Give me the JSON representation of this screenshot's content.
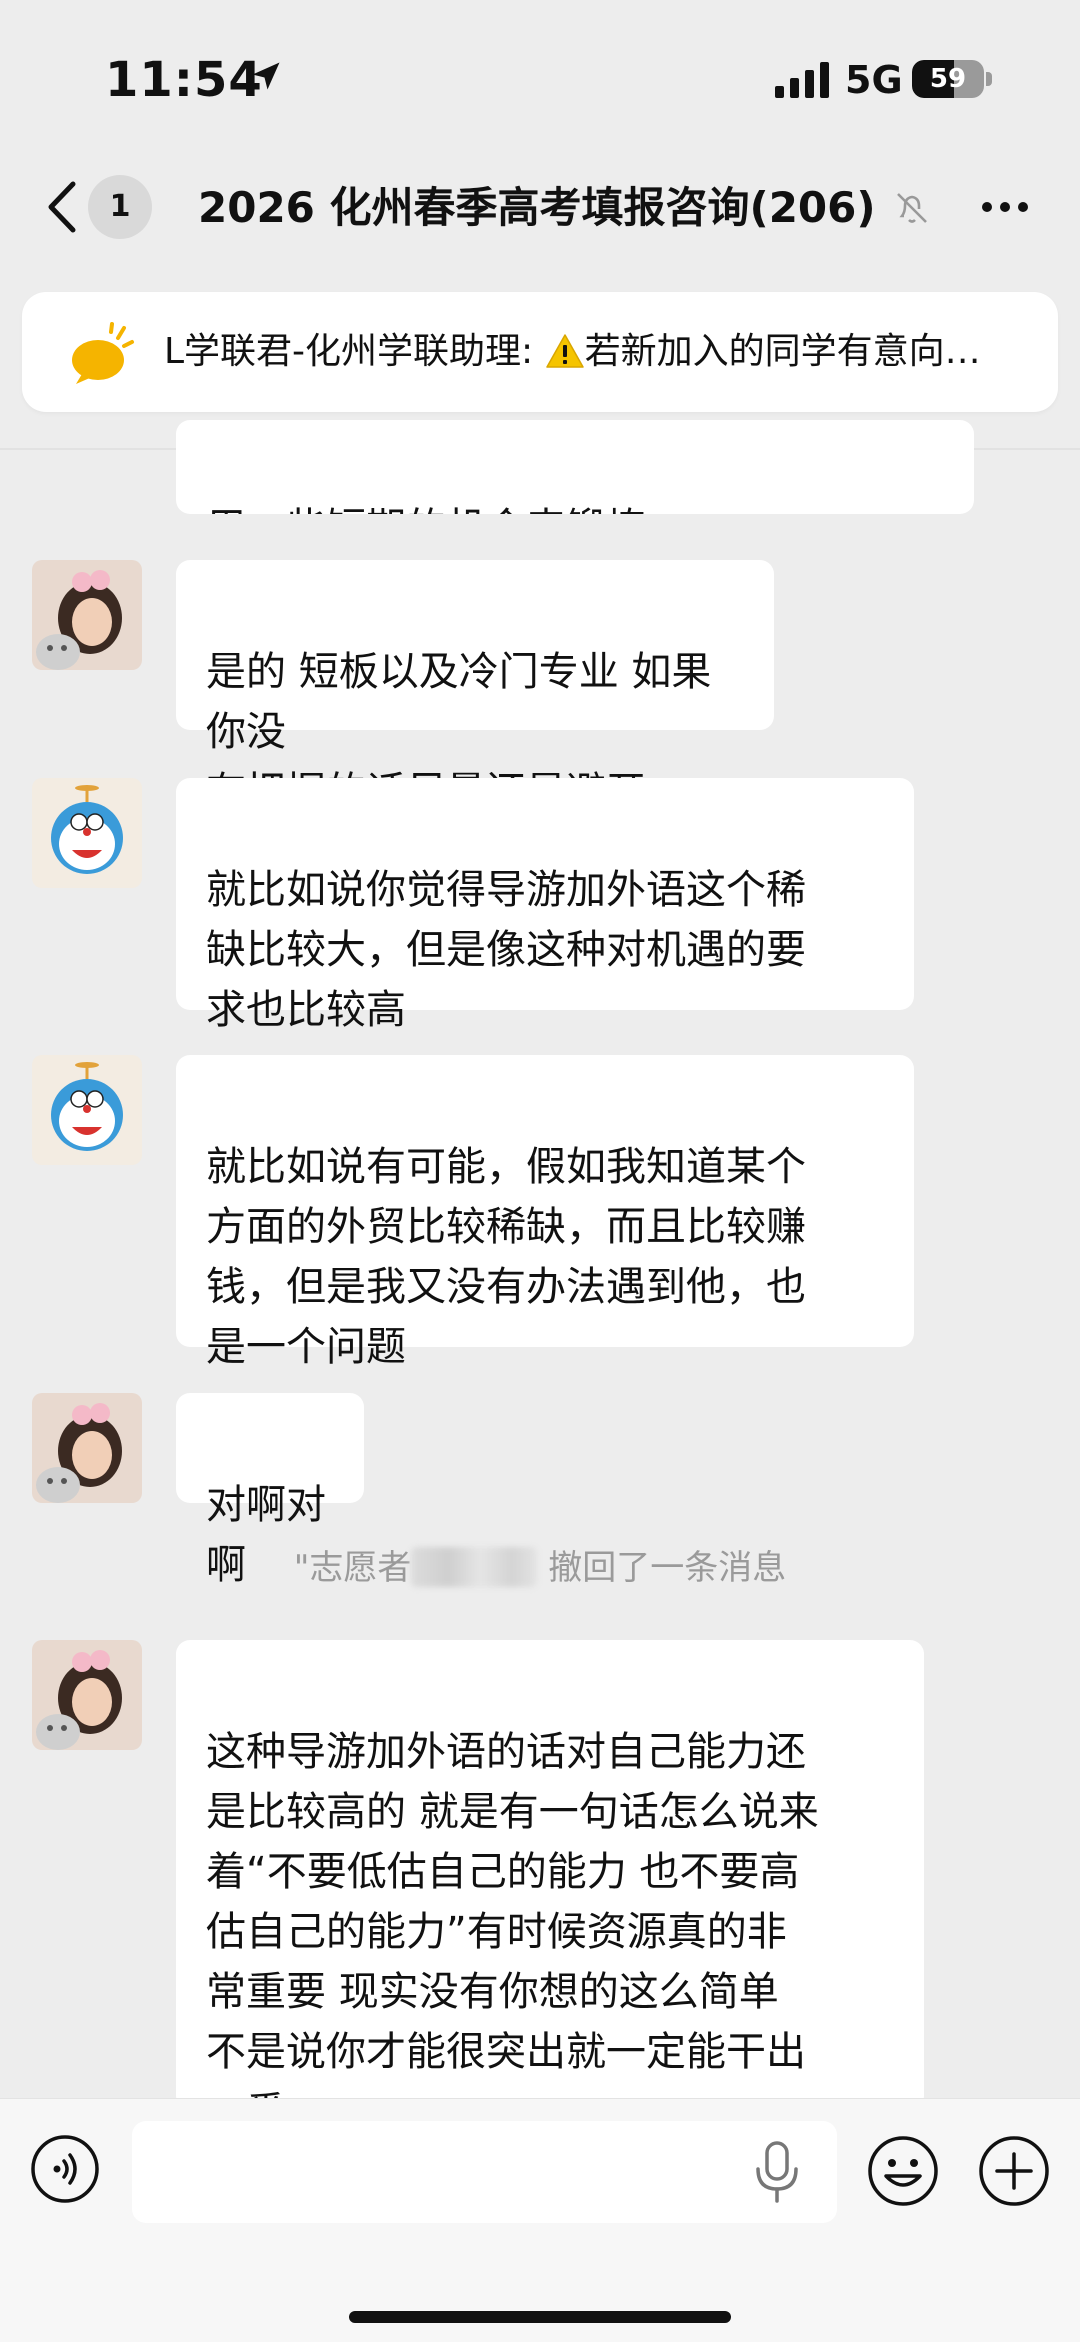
{
  "status": {
    "time": "11:54",
    "network": "5G",
    "battery": "59",
    "battery_level": 0.59
  },
  "header": {
    "unread": "1",
    "title": "2026 化州春季高考填报咨询(206)"
  },
  "pinned": {
    "sender": "L学联君-化州学联助理: ",
    "text": "若新加入的同学有意向…"
  },
  "messages": [
    {
      "avatar": "girl-cat-avatar",
      "text": "用一些短期的机会来锻炼"
    },
    {
      "avatar": "girl-cat-avatar",
      "text": "是的 短板以及冷门专业 如果你没\n有把握的话尽量还是避开"
    },
    {
      "avatar": "doraemon-avatar",
      "text": "就比如说你觉得导游加外语这个稀\n缺比较大，但是像这种对机遇的要\n求也比较高"
    },
    {
      "avatar": "doraemon-avatar",
      "text": "就比如说有可能，假如我知道某个\n方面的外贸比较稀缺，而且比较赚\n钱，但是我又没有办法遇到他，也\n是一个问题"
    },
    {
      "avatar": "girl-cat-avatar",
      "text": "对啊对啊"
    },
    {
      "avatar": "girl-cat-avatar",
      "text": "这种导游加外语的话对自己能力还\n是比较高的 就是有一句话怎么说来\n着“不要低估自己的能力 也不要高\n估自己的能力”有时候资源真的非\n常重要 现实没有你想的这么简单\n不是说你才能很突出就一定能干出\n一番"
    }
  ],
  "system_notice": {
    "prefix": "\"志愿者",
    "suffix": " 撤回了一条消息"
  },
  "colors": {
    "background": "#ededed",
    "bubble": "#ffffff",
    "notice_icon": "#f5b400",
    "warning": "#f5c400"
  }
}
